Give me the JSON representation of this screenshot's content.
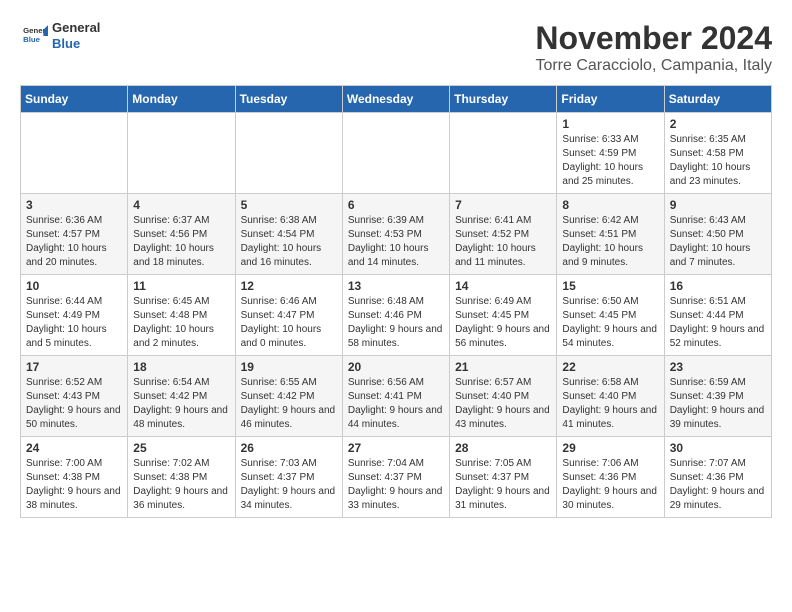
{
  "header": {
    "logo_general": "General",
    "logo_blue": "Blue",
    "title": "November 2024",
    "location": "Torre Caracciolo, Campania, Italy"
  },
  "days_of_week": [
    "Sunday",
    "Monday",
    "Tuesday",
    "Wednesday",
    "Thursday",
    "Friday",
    "Saturday"
  ],
  "weeks": [
    [
      {
        "day": "",
        "info": ""
      },
      {
        "day": "",
        "info": ""
      },
      {
        "day": "",
        "info": ""
      },
      {
        "day": "",
        "info": ""
      },
      {
        "day": "",
        "info": ""
      },
      {
        "day": "1",
        "info": "Sunrise: 6:33 AM\nSunset: 4:59 PM\nDaylight: 10 hours and 25 minutes."
      },
      {
        "day": "2",
        "info": "Sunrise: 6:35 AM\nSunset: 4:58 PM\nDaylight: 10 hours and 23 minutes."
      }
    ],
    [
      {
        "day": "3",
        "info": "Sunrise: 6:36 AM\nSunset: 4:57 PM\nDaylight: 10 hours and 20 minutes."
      },
      {
        "day": "4",
        "info": "Sunrise: 6:37 AM\nSunset: 4:56 PM\nDaylight: 10 hours and 18 minutes."
      },
      {
        "day": "5",
        "info": "Sunrise: 6:38 AM\nSunset: 4:54 PM\nDaylight: 10 hours and 16 minutes."
      },
      {
        "day": "6",
        "info": "Sunrise: 6:39 AM\nSunset: 4:53 PM\nDaylight: 10 hours and 14 minutes."
      },
      {
        "day": "7",
        "info": "Sunrise: 6:41 AM\nSunset: 4:52 PM\nDaylight: 10 hours and 11 minutes."
      },
      {
        "day": "8",
        "info": "Sunrise: 6:42 AM\nSunset: 4:51 PM\nDaylight: 10 hours and 9 minutes."
      },
      {
        "day": "9",
        "info": "Sunrise: 6:43 AM\nSunset: 4:50 PM\nDaylight: 10 hours and 7 minutes."
      }
    ],
    [
      {
        "day": "10",
        "info": "Sunrise: 6:44 AM\nSunset: 4:49 PM\nDaylight: 10 hours and 5 minutes."
      },
      {
        "day": "11",
        "info": "Sunrise: 6:45 AM\nSunset: 4:48 PM\nDaylight: 10 hours and 2 minutes."
      },
      {
        "day": "12",
        "info": "Sunrise: 6:46 AM\nSunset: 4:47 PM\nDaylight: 10 hours and 0 minutes."
      },
      {
        "day": "13",
        "info": "Sunrise: 6:48 AM\nSunset: 4:46 PM\nDaylight: 9 hours and 58 minutes."
      },
      {
        "day": "14",
        "info": "Sunrise: 6:49 AM\nSunset: 4:45 PM\nDaylight: 9 hours and 56 minutes."
      },
      {
        "day": "15",
        "info": "Sunrise: 6:50 AM\nSunset: 4:45 PM\nDaylight: 9 hours and 54 minutes."
      },
      {
        "day": "16",
        "info": "Sunrise: 6:51 AM\nSunset: 4:44 PM\nDaylight: 9 hours and 52 minutes."
      }
    ],
    [
      {
        "day": "17",
        "info": "Sunrise: 6:52 AM\nSunset: 4:43 PM\nDaylight: 9 hours and 50 minutes."
      },
      {
        "day": "18",
        "info": "Sunrise: 6:54 AM\nSunset: 4:42 PM\nDaylight: 9 hours and 48 minutes."
      },
      {
        "day": "19",
        "info": "Sunrise: 6:55 AM\nSunset: 4:42 PM\nDaylight: 9 hours and 46 minutes."
      },
      {
        "day": "20",
        "info": "Sunrise: 6:56 AM\nSunset: 4:41 PM\nDaylight: 9 hours and 44 minutes."
      },
      {
        "day": "21",
        "info": "Sunrise: 6:57 AM\nSunset: 4:40 PM\nDaylight: 9 hours and 43 minutes."
      },
      {
        "day": "22",
        "info": "Sunrise: 6:58 AM\nSunset: 4:40 PM\nDaylight: 9 hours and 41 minutes."
      },
      {
        "day": "23",
        "info": "Sunrise: 6:59 AM\nSunset: 4:39 PM\nDaylight: 9 hours and 39 minutes."
      }
    ],
    [
      {
        "day": "24",
        "info": "Sunrise: 7:00 AM\nSunset: 4:38 PM\nDaylight: 9 hours and 38 minutes."
      },
      {
        "day": "25",
        "info": "Sunrise: 7:02 AM\nSunset: 4:38 PM\nDaylight: 9 hours and 36 minutes."
      },
      {
        "day": "26",
        "info": "Sunrise: 7:03 AM\nSunset: 4:37 PM\nDaylight: 9 hours and 34 minutes."
      },
      {
        "day": "27",
        "info": "Sunrise: 7:04 AM\nSunset: 4:37 PM\nDaylight: 9 hours and 33 minutes."
      },
      {
        "day": "28",
        "info": "Sunrise: 7:05 AM\nSunset: 4:37 PM\nDaylight: 9 hours and 31 minutes."
      },
      {
        "day": "29",
        "info": "Sunrise: 7:06 AM\nSunset: 4:36 PM\nDaylight: 9 hours and 30 minutes."
      },
      {
        "day": "30",
        "info": "Sunrise: 7:07 AM\nSunset: 4:36 PM\nDaylight: 9 hours and 29 minutes."
      }
    ]
  ]
}
